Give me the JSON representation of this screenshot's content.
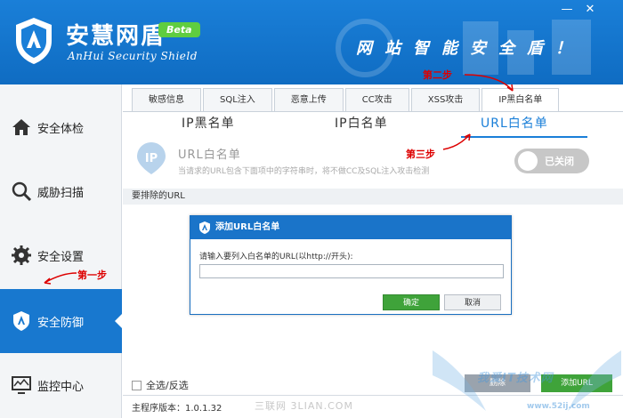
{
  "app": {
    "title": "安慧网盾",
    "subtitle": "AnHui Security Shield",
    "beta": "Beta",
    "slogan": "网站智能安全盾！"
  },
  "window": {
    "minimize": "—",
    "close": "✕"
  },
  "sidebar": {
    "items": [
      {
        "label": "安全体检",
        "icon": "home-icon"
      },
      {
        "label": "威胁扫描",
        "icon": "magnifier-icon"
      },
      {
        "label": "安全设置",
        "icon": "gear-icon"
      },
      {
        "label": "安全防御",
        "icon": "shield-icon",
        "active": true
      },
      {
        "label": "监控中心",
        "icon": "monitor-icon"
      }
    ]
  },
  "tabs": [
    {
      "label": "敏感信息"
    },
    {
      "label": "SQL注入"
    },
    {
      "label": "恶意上传"
    },
    {
      "label": "CC攻击"
    },
    {
      "label": "XSS攻击"
    },
    {
      "label": "IP黑白名单",
      "active": true
    }
  ],
  "subtabs": [
    {
      "label": "IP黑名单"
    },
    {
      "label": "IP白名单"
    },
    {
      "label": "URL白名单",
      "active": true
    }
  ],
  "panel": {
    "title": "URL白名单",
    "desc": "当请求的URL包含下面项中的字符串时，将不做CC及SQL注入攻击检测",
    "toggle": "已关闭",
    "list_header": "要排除的URL"
  },
  "footer": {
    "select_all": "全选/反选",
    "delete": "删除",
    "add_url": "添加URL",
    "version": "主程序版本：1.0.1.32"
  },
  "dialog": {
    "title": "添加URL白名单",
    "label": "请输入要列入白名单的URL(以http://开头):",
    "input_value": "",
    "ok": "确定",
    "cancel": "取消"
  },
  "annotations": {
    "step1": "第一步",
    "step2": "第二步",
    "step3": "第三步"
  },
  "watermark": {
    "bottom": "三联网 3LIAN.COM",
    "brand": "我爱IT技术网",
    "url": "www.52ij.com"
  },
  "colors": {
    "header_blue": "#1a7fd8",
    "active_blue": "#1878cf",
    "green": "#3fa33a",
    "annotation_red": "#dd0000"
  }
}
